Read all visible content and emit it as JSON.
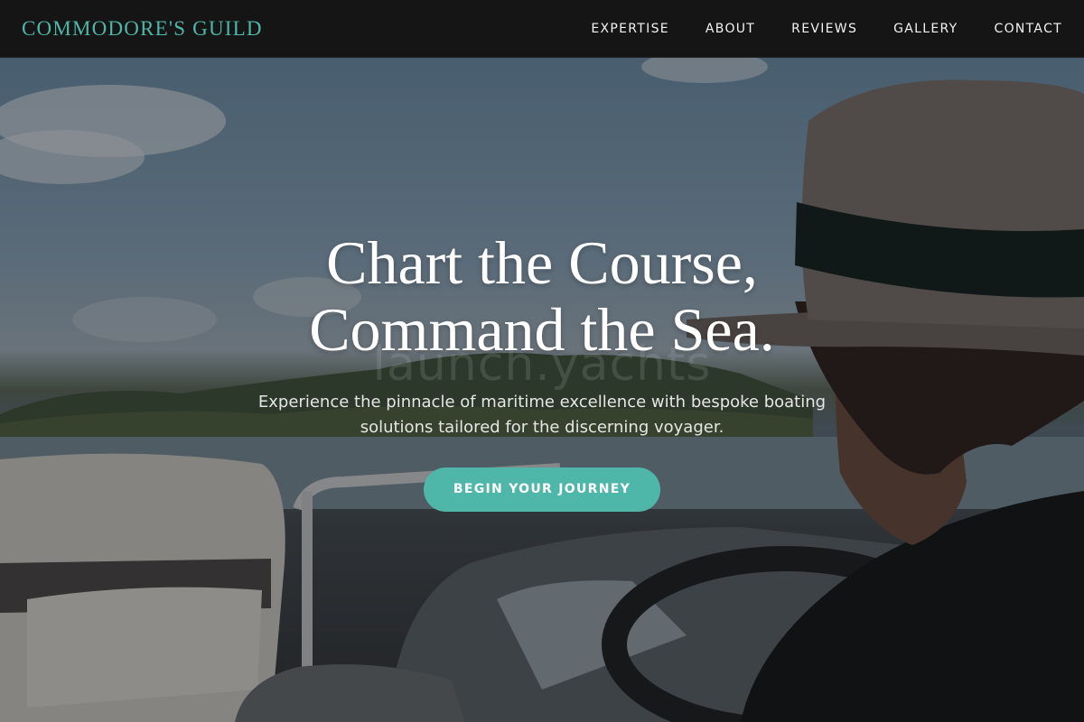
{
  "brand": {
    "name": "COMMODORE'S GUILD",
    "color": "#4fb6aa"
  },
  "nav": {
    "items": [
      {
        "label": "EXPERTISE"
      },
      {
        "label": "ABOUT"
      },
      {
        "label": "REVIEWS"
      },
      {
        "label": "GALLERY"
      },
      {
        "label": "CONTACT"
      }
    ]
  },
  "hero": {
    "background_image": "man-in-hat-steering-boat",
    "watermark": "launch.yachts",
    "title_line1": "Chart the Course,",
    "title_line2": "Command the Sea.",
    "subtitle": "Experience the pinnacle of maritime excellence with bespoke boating solutions tailored for the discerning voyager.",
    "cta_label": "BEGIN YOUR JOURNEY",
    "accent_color": "#4fb6aa"
  }
}
